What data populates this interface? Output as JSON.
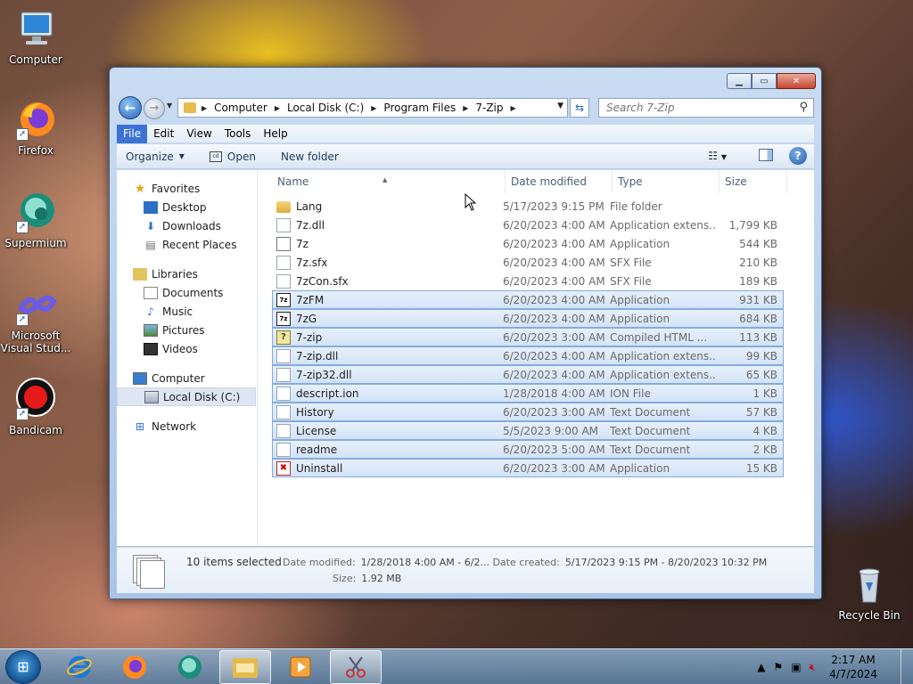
{
  "desktop": {
    "icons": [
      {
        "label": "Computer"
      },
      {
        "label": "Firefox"
      },
      {
        "label": "Supermium"
      },
      {
        "label": "Microsoft Visual Stud..."
      },
      {
        "label": "Bandicam"
      },
      {
        "label": "Recycle Bin"
      }
    ]
  },
  "address": {
    "crumbs": [
      "Computer",
      "Local Disk (C:)",
      "Program Files",
      "7-Zip"
    ]
  },
  "search": {
    "placeholder": "Search 7-Zip"
  },
  "menu": [
    "File",
    "Edit",
    "View",
    "Tools",
    "Help"
  ],
  "commands": {
    "organize": "Organize",
    "open": "Open",
    "new_folder": "New folder"
  },
  "nav": {
    "favorites": "Favorites",
    "desktop": "Desktop",
    "downloads": "Downloads",
    "recent": "Recent Places",
    "libraries": "Libraries",
    "documents": "Documents",
    "music": "Music",
    "pictures": "Pictures",
    "videos": "Videos",
    "computer": "Computer",
    "local_disk": "Local Disk (C:)",
    "network": "Network"
  },
  "columns": {
    "name": "Name",
    "date": "Date modified",
    "type": "Type",
    "size": "Size"
  },
  "files": [
    {
      "name": "Lang",
      "date": "5/17/2023 9:15 PM",
      "type": "File folder",
      "size": "",
      "icon": "folder",
      "selected": false
    },
    {
      "name": "7z.dll",
      "date": "6/20/2023 4:00 AM",
      "type": "Application extens...",
      "size": "1,799 KB",
      "icon": "doc",
      "selected": false
    },
    {
      "name": "7z",
      "date": "6/20/2023 4:00 AM",
      "type": "Application",
      "size": "544 KB",
      "icon": "app",
      "selected": false
    },
    {
      "name": "7z.sfx",
      "date": "6/20/2023 4:00 AM",
      "type": "SFX File",
      "size": "210 KB",
      "icon": "doc",
      "selected": false
    },
    {
      "name": "7zCon.sfx",
      "date": "6/20/2023 4:00 AM",
      "type": "SFX File",
      "size": "189 KB",
      "icon": "doc",
      "selected": false
    },
    {
      "name": "7zFM",
      "date": "6/20/2023 4:00 AM",
      "type": "Application",
      "size": "931 KB",
      "icon": "7z",
      "selected": true
    },
    {
      "name": "7zG",
      "date": "6/20/2023 4:00 AM",
      "type": "Application",
      "size": "684 KB",
      "icon": "7z",
      "selected": true
    },
    {
      "name": "7-zip",
      "date": "6/20/2023 3:00 AM",
      "type": "Compiled HTML ...",
      "size": "113 KB",
      "icon": "chm",
      "selected": true
    },
    {
      "name": "7-zip.dll",
      "date": "6/20/2023 4:00 AM",
      "type": "Application extens...",
      "size": "99 KB",
      "icon": "doc",
      "selected": true
    },
    {
      "name": "7-zip32.dll",
      "date": "6/20/2023 4:00 AM",
      "type": "Application extens...",
      "size": "65 KB",
      "icon": "doc",
      "selected": true
    },
    {
      "name": "descript.ion",
      "date": "1/28/2018 4:00 AM",
      "type": "ION File",
      "size": "1 KB",
      "icon": "doc",
      "selected": true
    },
    {
      "name": "History",
      "date": "6/20/2023 3:00 AM",
      "type": "Text Document",
      "size": "57 KB",
      "icon": "doc",
      "selected": true
    },
    {
      "name": "License",
      "date": "5/5/2023 9:00 AM",
      "type": "Text Document",
      "size": "4 KB",
      "icon": "doc",
      "selected": true
    },
    {
      "name": "readme",
      "date": "6/20/2023 5:00 AM",
      "type": "Text Document",
      "size": "2 KB",
      "icon": "doc",
      "selected": true
    },
    {
      "name": "Uninstall",
      "date": "6/20/2023 3:00 AM",
      "type": "Application",
      "size": "15 KB",
      "icon": "uninstall",
      "selected": true
    }
  ],
  "details": {
    "selected": "10 items selected",
    "date_modified_label": "Date modified:",
    "date_modified": "1/28/2018 4:00 AM - 6/2...",
    "date_created_label": "Date created:",
    "date_created": "5/17/2023 9:15 PM - 8/20/2023 10:32 PM",
    "size_label": "Size:",
    "size": "1.92 MB"
  },
  "taskbar": {
    "time": "2:17 AM",
    "date": "4/7/2024"
  },
  "colors": {
    "selection": "#d3e3f7",
    "accent": "#3a73d3"
  }
}
